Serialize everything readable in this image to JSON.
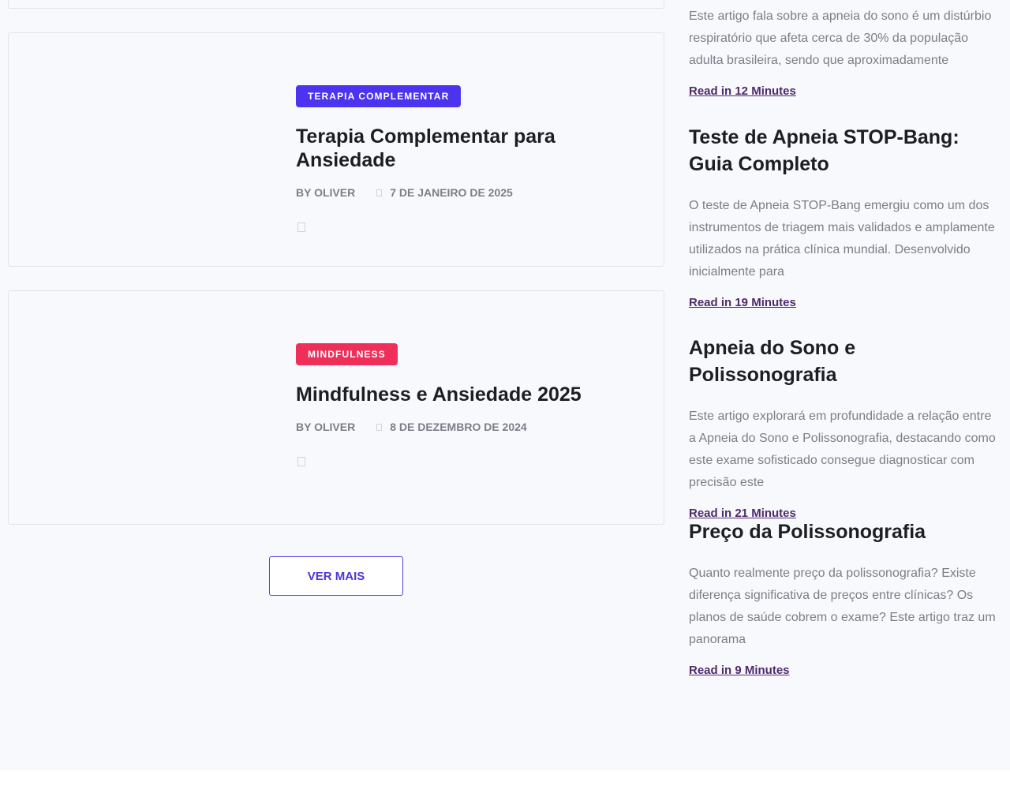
{
  "posts": [
    {
      "category": "TERAPIA COMPLEMENTAR",
      "category_color": "#4b33f0",
      "title": "Terapia Complementar para Ansiedade",
      "author": "BY OLIVER",
      "date": "7 DE JANEIRO DE 2025"
    },
    {
      "category": "MINDFULNESS",
      "category_color": "#ef2f5a",
      "title": "Mindfulness e Ansiedade 2025",
      "author": "BY OLIVER",
      "date": "8 DE DEZEMBRO DE 2024"
    }
  ],
  "load_more_label": "VER MAIS",
  "sidebar": {
    "partial_excerpt": "Este artigo fala sobre a apneia do sono é um distúrbio respiratório que afeta cerca de 30% da população adulta brasileira, sendo que aproximadamente",
    "partial_link": "Read in 12 Minutes",
    "articles": [
      {
        "title": "Teste de Apneia STOP-Bang: Guia Completo",
        "excerpt": "O teste de Apneia STOP-Bang emergiu como um dos instrumentos de triagem mais validados e amplamente utilizados na prática clínica mundial. Desenvolvido inicialmente para",
        "link": "Read in 19 Minutes"
      },
      {
        "title": "Apneia do Sono e Polissonografia",
        "excerpt": "Este artigo explorará em profundidade a relação entre a Apneia do Sono e Polissonografia, destacando como este exame sofisticado consegue diagnosticar com precisão este",
        "link": "Read in 21 Minutes"
      },
      {
        "title": "Preço da Polissonografia",
        "excerpt": "Quanto realmente preço da polissonografia? Existe diferença significativa de preços entre clínicas? Os planos de saúde cobrem o exame? Este artigo traz um panorama",
        "link": "Read in 9 Minutes"
      }
    ]
  }
}
